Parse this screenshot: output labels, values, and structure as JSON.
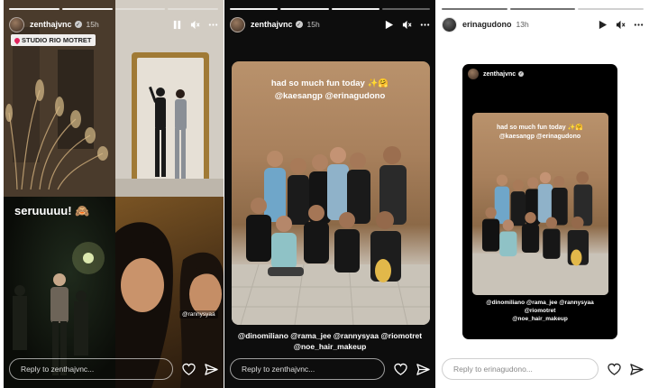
{
  "stories": [
    {
      "username": "zenthajvnc",
      "time": "15h",
      "segments": 4,
      "filled": 2,
      "controls": [
        "pause-icon",
        "mute-icon",
        "more-icon"
      ],
      "location": "STUDIO RIO MOTRET",
      "caption": "seruuuuu! 🙈",
      "tag": "@rannysyaa",
      "reply_placeholder": "Reply to zenthajvnc..."
    },
    {
      "username": "zenthajvnc",
      "time": "15h",
      "segments": 4,
      "filled": 3,
      "controls": [
        "play-icon",
        "mute-icon",
        "more-icon"
      ],
      "caption_line1": "had so much fun today ✨🤗",
      "caption_line2": "@kaesangp @erinagudono",
      "tags_line1": "@dinomiliano @rama_jee @rannysyaa @riomotret",
      "tags_line2": "@noe_hair_makeup",
      "reply_placeholder": "Reply to zenthajvnc..."
    },
    {
      "username": "erinagudono",
      "time": "13h",
      "segments": 3,
      "filled": 2,
      "controls": [
        "play-icon",
        "mute-icon",
        "more-icon"
      ],
      "repost_username": "zenthajvnc",
      "caption_line1": "had so much fun today ✨🤗",
      "caption_line2": "@kaesangp @erinagudono",
      "tags_line1": "@dinomiliano @rama_jee @rannysyaa @riomotret",
      "tags_line2": "@noe_hair_makeup",
      "reply_placeholder": "Reply to erinagudono..."
    }
  ],
  "colors": {
    "verified": "#cccccc",
    "location_pin": "#e0245e"
  }
}
